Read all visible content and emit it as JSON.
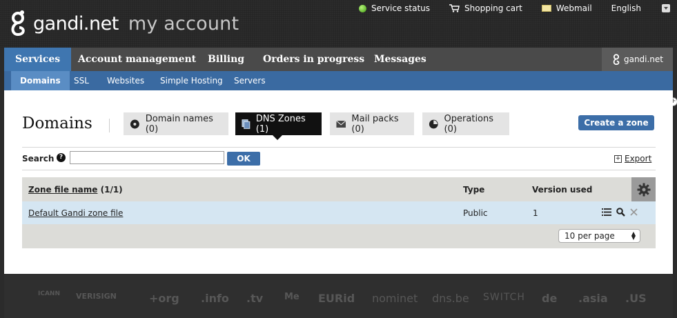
{
  "header": {
    "brand": "gandi.net",
    "subtitle": "my account",
    "links": {
      "service_status": "Service status",
      "shopping_cart": "Shopping cart",
      "webmail": "Webmail",
      "language": "English"
    }
  },
  "main_nav": {
    "items": [
      "Services",
      "Account management",
      "Billing",
      "Orders in progress",
      "Messages"
    ],
    "right_brand": "gandi.net"
  },
  "sub_nav": {
    "items": [
      "Domains",
      "SSL",
      "Websites",
      "Simple Hosting",
      "Servers"
    ]
  },
  "page": {
    "title": "Domains",
    "tabs": [
      {
        "label": "Domain names (0)",
        "icon": "disc-icon"
      },
      {
        "label": "DNS Zones (1)",
        "icon": "documents-icon"
      },
      {
        "label": "Mail packs (0)",
        "icon": "envelope-icon"
      },
      {
        "label": "Operations (0)",
        "icon": "clock-icon"
      }
    ],
    "create_button": "Create a zone"
  },
  "search": {
    "label": "Search",
    "help": "?",
    "value": "",
    "ok": "OK",
    "export": "Export"
  },
  "table": {
    "headers": {
      "name": "Zone file name",
      "count": "(1/1)",
      "type": "Type",
      "version": "Version used"
    },
    "rows": [
      {
        "name": "Default Gandi zone file",
        "type": "Public",
        "version": "1"
      }
    ],
    "per_page": "10 per page"
  },
  "footer": {
    "logos": [
      "ICANN",
      "VERISIGN",
      "+org",
      ".info",
      ".tv",
      "Me",
      "EURid",
      "nominet",
      "dns.be",
      "SWITCH",
      "de",
      ".asia",
      ".US"
    ]
  },
  "colors": {
    "accent_blue": "#3f76b0",
    "button_blue": "#3c6ea8",
    "row_highlight": "#d5e6f2"
  }
}
